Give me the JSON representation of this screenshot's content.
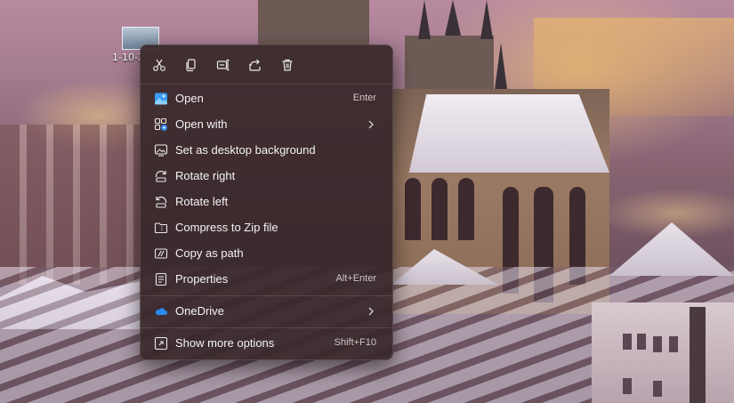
{
  "desktop": {
    "icon_label": "1-10-2"
  },
  "toolbar": {
    "buttons": [
      {
        "name": "cut-icon"
      },
      {
        "name": "copy-icon"
      },
      {
        "name": "rename-icon"
      },
      {
        "name": "share-icon"
      },
      {
        "name": "delete-icon"
      }
    ]
  },
  "menu": {
    "items": [
      {
        "label": "Open",
        "shortcut": "Enter",
        "icon": "photo-icon"
      },
      {
        "label": "Open with",
        "submenu": true,
        "icon": "open-with-icon"
      },
      {
        "label": "Set as desktop background",
        "icon": "desktop-background-icon"
      },
      {
        "label": "Rotate right",
        "icon": "rotate-right-icon"
      },
      {
        "label": "Rotate left",
        "icon": "rotate-left-icon"
      },
      {
        "label": "Compress to Zip file",
        "icon": "zip-folder-icon"
      },
      {
        "label": "Copy as path",
        "icon": "copy-path-icon"
      },
      {
        "label": "Properties",
        "shortcut": "Alt+Enter",
        "icon": "properties-icon"
      },
      {
        "label": "OneDrive",
        "submenu": true,
        "icon": "onedrive-cloud-icon"
      },
      {
        "label": "Show more options",
        "shortcut": "Shift+F10",
        "icon": "show-more-icon"
      }
    ]
  },
  "colors": {
    "menu_bg": "#38282a",
    "onedrive_blue": "#2a8af0",
    "photos_blue": "#3a9cf0"
  }
}
